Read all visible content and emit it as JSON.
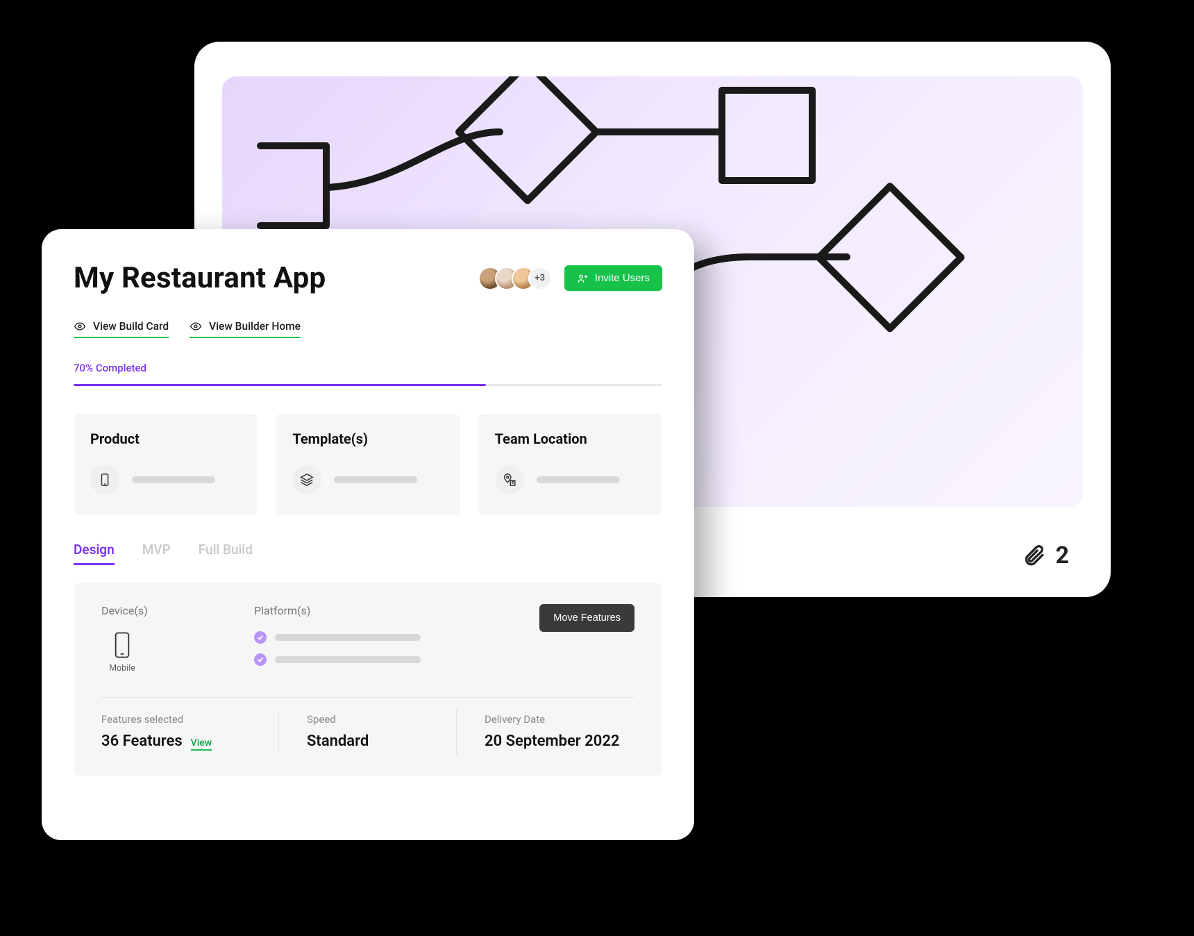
{
  "diagram": {
    "attachment_count": "2"
  },
  "header": {
    "title": "My Restaurant App",
    "extra_avatars": "+3",
    "invite_label": "Invite Users"
  },
  "sublinks": {
    "build_card": "View Build Card",
    "builder_home": "View Builder Home"
  },
  "progress": {
    "label": "70% Completed",
    "percent": 70
  },
  "info": {
    "product_title": "Product",
    "templates_title": "Template(s)",
    "team_title": "Team Location"
  },
  "tabs": {
    "design": "Design",
    "mvp": "MVP",
    "full": "Full Build"
  },
  "details": {
    "devices_label": "Device(s)",
    "device_name": "Mobile",
    "platforms_label": "Platform(s)",
    "move_label": "Move Features",
    "features_label": "Features selected",
    "features_value": "36 Features",
    "features_view": "View",
    "speed_label": "Speed",
    "speed_value": "Standard",
    "delivery_label": "Delivery Date",
    "delivery_value": "20 September 2022"
  }
}
